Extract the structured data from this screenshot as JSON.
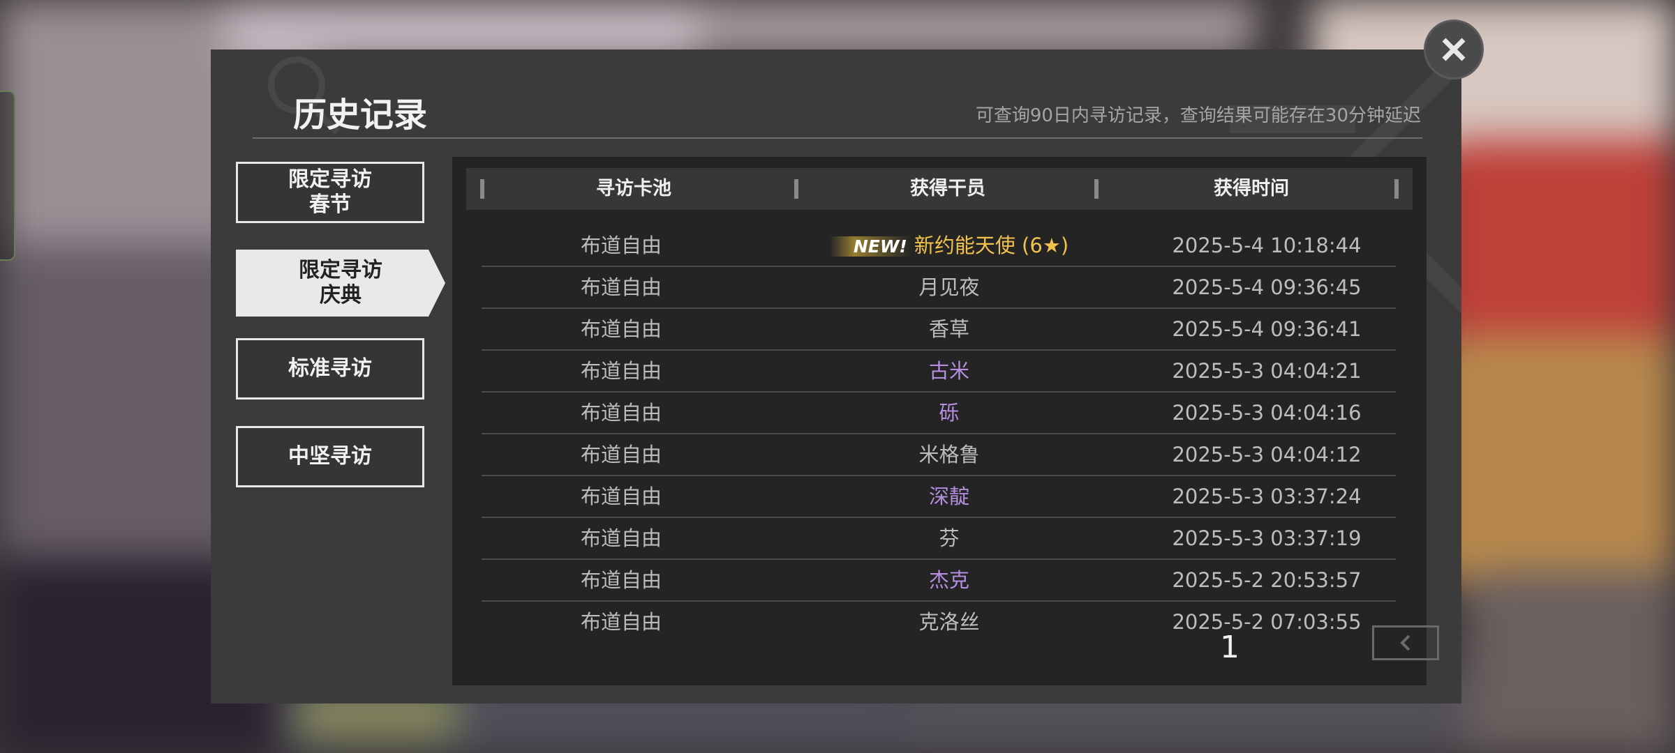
{
  "header": {
    "title": "历史记录",
    "hint": "可查询90日内寻访记录，查询结果可能存在30分钟延迟"
  },
  "tabs": [
    {
      "label": "限定寻访\n春节",
      "active": false
    },
    {
      "label": "限定寻访\n庆典",
      "active": true
    },
    {
      "label": "标准寻访",
      "active": false
    },
    {
      "label": "中坚寻访",
      "active": false
    }
  ],
  "table": {
    "columns": [
      "寻访卡池",
      "获得干员",
      "获得时间"
    ],
    "new_badge": "NEW!",
    "rows": [
      {
        "pool": "布道自由",
        "operator": "新约能天使 (6★)",
        "time": "2025-5-4 10:18:44",
        "color": "#f2c24a",
        "is_new": true
      },
      {
        "pool": "布道自由",
        "operator": "月见夜",
        "time": "2025-5-4 09:36:45",
        "color": "#bdbdbd"
      },
      {
        "pool": "布道自由",
        "operator": "香草",
        "time": "2025-5-4 09:36:41",
        "color": "#bdbdbd"
      },
      {
        "pool": "布道自由",
        "operator": "古米",
        "time": "2025-5-3 04:04:21",
        "color": "#b58ee0"
      },
      {
        "pool": "布道自由",
        "operator": "砾",
        "time": "2025-5-3 04:04:16",
        "color": "#b58ee0"
      },
      {
        "pool": "布道自由",
        "operator": "米格鲁",
        "time": "2025-5-3 04:04:12",
        "color": "#bdbdbd"
      },
      {
        "pool": "布道自由",
        "operator": "深靛",
        "time": "2025-5-3 03:37:24",
        "color": "#b58ee0"
      },
      {
        "pool": "布道自由",
        "operator": "芬",
        "time": "2025-5-3 03:37:19",
        "color": "#bdbdbd"
      },
      {
        "pool": "布道自由",
        "operator": "杰克",
        "time": "2025-5-2 20:53:57",
        "color": "#b58ee0"
      },
      {
        "pool": "布道自由",
        "operator": "克洛丝",
        "time": "2025-5-2 07:03:55",
        "color": "#bdbdbd"
      }
    ]
  },
  "pagination": {
    "current_page": "1",
    "prev_icon": "chevron-left-icon",
    "next_icon": "chevron-right-icon",
    "prev_disabled": true
  },
  "close_icon": "close-icon"
}
